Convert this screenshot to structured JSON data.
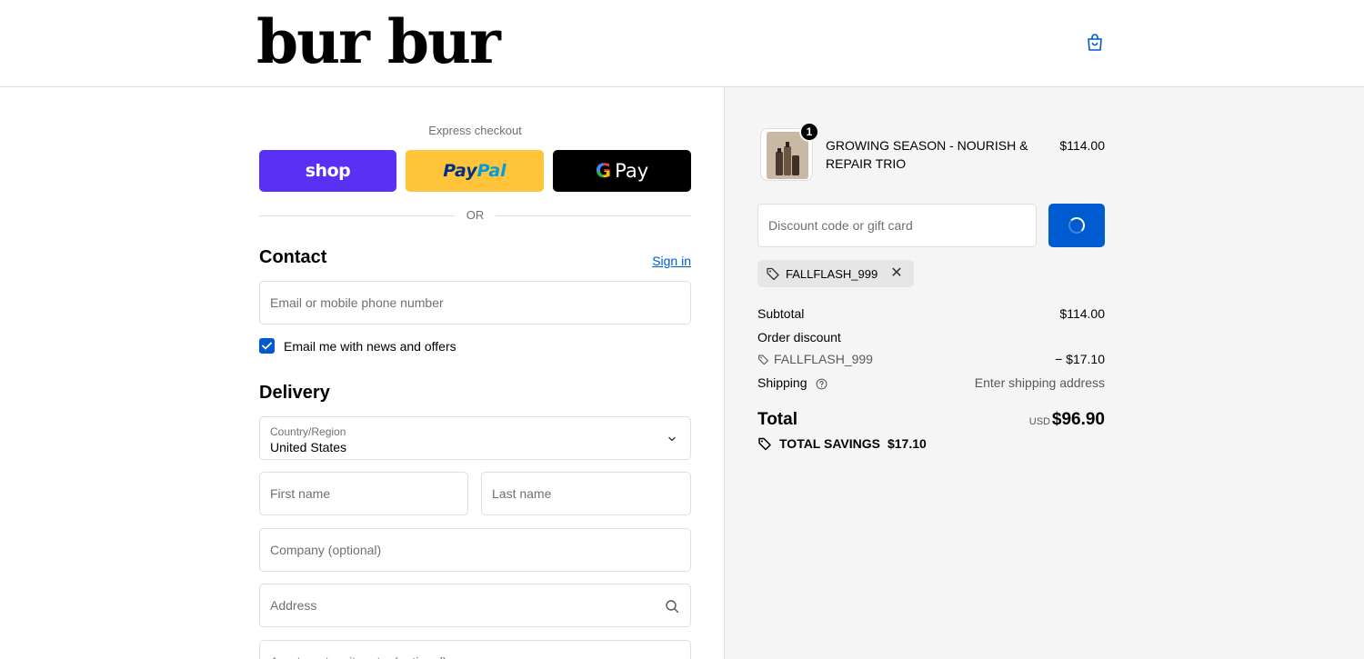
{
  "brand": {
    "name": "bur bur"
  },
  "header": {
    "cart_icon": "shopping-bag-icon"
  },
  "express": {
    "label": "Express checkout",
    "shop_label": "shop",
    "paypal_label_1": "Pay",
    "paypal_label_2": "Pal",
    "gpay_g": "G",
    "gpay_label": "Pay",
    "or_label": "OR"
  },
  "contact": {
    "title": "Contact",
    "signin_label": "Sign in",
    "email_placeholder": "Email or mobile phone number",
    "newsletter_checked": true,
    "newsletter_label": "Email me with news and offers"
  },
  "delivery": {
    "title": "Delivery",
    "country_label": "Country/Region",
    "country_value": "United States",
    "first_name_placeholder": "First name",
    "last_name_placeholder": "Last name",
    "company_placeholder": "Company (optional)",
    "address_placeholder": "Address",
    "apartment_placeholder": "Apartment, suite, etc. (optional)"
  },
  "order": {
    "item": {
      "name": "GROWING SEASON - NOURISH & REPAIR TRIO",
      "price": "$114.00",
      "quantity": "1"
    },
    "discount_placeholder": "Discount code or gift card",
    "applied_code": "FALLFLASH_999",
    "subtotal_label": "Subtotal",
    "subtotal_value": "$114.00",
    "order_discount_label": "Order discount",
    "discount_code": "FALLFLASH_999",
    "discount_value": "− $17.10",
    "shipping_label": "Shipping",
    "shipping_value": "Enter shipping address",
    "total_label": "Total",
    "currency": "USD",
    "total_value": "$96.90",
    "savings_label": "TOTAL SAVINGS",
    "savings_value": "$17.10"
  },
  "colors": {
    "primary": "#005bd1",
    "shop_purple": "#5a31f4",
    "paypal_yellow": "#ffc439",
    "summary_bg": "#f5f5f5"
  }
}
